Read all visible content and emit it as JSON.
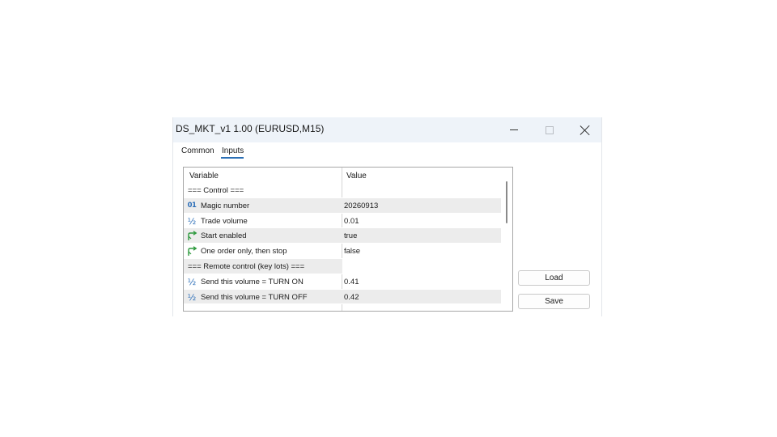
{
  "window": {
    "title": "DS_MKT_v1 1.00 (EURUSD,M15)"
  },
  "tabs": [
    {
      "label": "Common",
      "active": false
    },
    {
      "label": "Inputs",
      "active": true
    }
  ],
  "grid": {
    "columns": {
      "variable": "Variable",
      "value": "Value"
    },
    "rows": [
      {
        "kind": "section",
        "variable": "=== Control ===",
        "value": ""
      },
      {
        "kind": "param",
        "icon": "integer-icon",
        "variable": "Magic number",
        "value": "20260913"
      },
      {
        "kind": "param",
        "icon": "fraction-icon",
        "variable": "Trade volume",
        "value": "0.01"
      },
      {
        "kind": "param",
        "icon": "boolean-arrow-icon",
        "variable": "Start enabled",
        "value": "true"
      },
      {
        "kind": "param",
        "icon": "boolean-arrow-icon",
        "variable": "One order only, then stop",
        "value": "false"
      },
      {
        "kind": "section",
        "variable": "=== Remote control (key lots) ===",
        "value": ""
      },
      {
        "kind": "param",
        "icon": "fraction-icon",
        "variable": "Send this volume = TURN ON",
        "value": "0.41"
      },
      {
        "kind": "param",
        "icon": "fraction-icon",
        "variable": "Send this volume = TURN OFF",
        "value": "0.42"
      }
    ]
  },
  "buttons": {
    "load": "Load",
    "save": "Save"
  },
  "icon_glyphs": {
    "integer-icon": "01",
    "fraction-icon": "½"
  },
  "colors": {
    "titlebar_bg": "#eef3f9",
    "tab_underline": "#2b6fb5",
    "icon_blue": "#2d6fb8",
    "icon_green": "#2e9a3e",
    "row_shade": "#ececec"
  }
}
